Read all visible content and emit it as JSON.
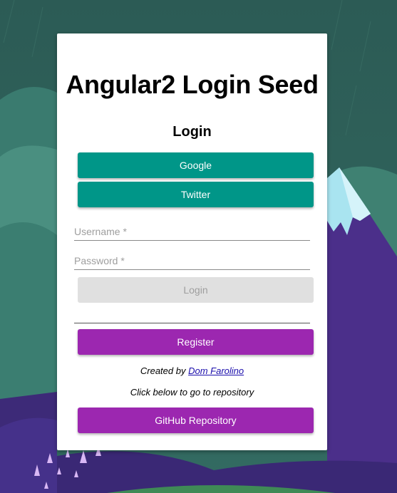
{
  "app": {
    "title": "Angular2 Login Seed"
  },
  "login": {
    "heading": "Login",
    "google_label": "Google",
    "twitter_label": "Twitter",
    "username_placeholder": "Username *",
    "password_placeholder": "Password *",
    "login_label": "Login",
    "register_label": "Register"
  },
  "footer": {
    "created_by_prefix": "Created by",
    "author_name": "Dom Farolino",
    "repo_hint": "Click below to go to repository",
    "github_label": "GitHub Repository"
  },
  "colors": {
    "teal": "#009688",
    "purple": "#9c27b0",
    "disabled": "#e0e0e0",
    "background": "#2f5d56"
  }
}
